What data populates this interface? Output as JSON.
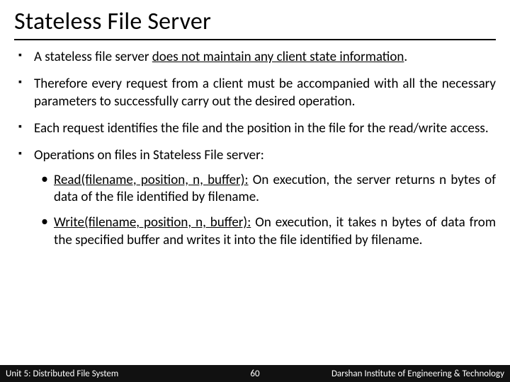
{
  "title": "Stateless File Server",
  "bullets": {
    "b1a": "A stateless file server ",
    "b1b": "does not maintain any client state information",
    "b1c": ".",
    "b2": "Therefore every request from a client must be accompanied with all the necessary parameters to successfully carry out the desired operation.",
    "b3": "Each request identifies the file and the position in the file for the read/write access.",
    "b4": "Operations on files in Stateless File server:",
    "s1a": "Read(filename, position, n, buffer):",
    "s1b": " On execution, the server returns n bytes of data of the file identified by filename.",
    "s2a": "Write(filename, position, n, buffer):",
    "s2b": " On execution, it takes n bytes of data from the specified buffer and writes it into the file identified by filename."
  },
  "footer": {
    "left": "Unit 5: Distributed File System",
    "center": "60",
    "right": "Darshan Institute of Engineering & Technology"
  }
}
